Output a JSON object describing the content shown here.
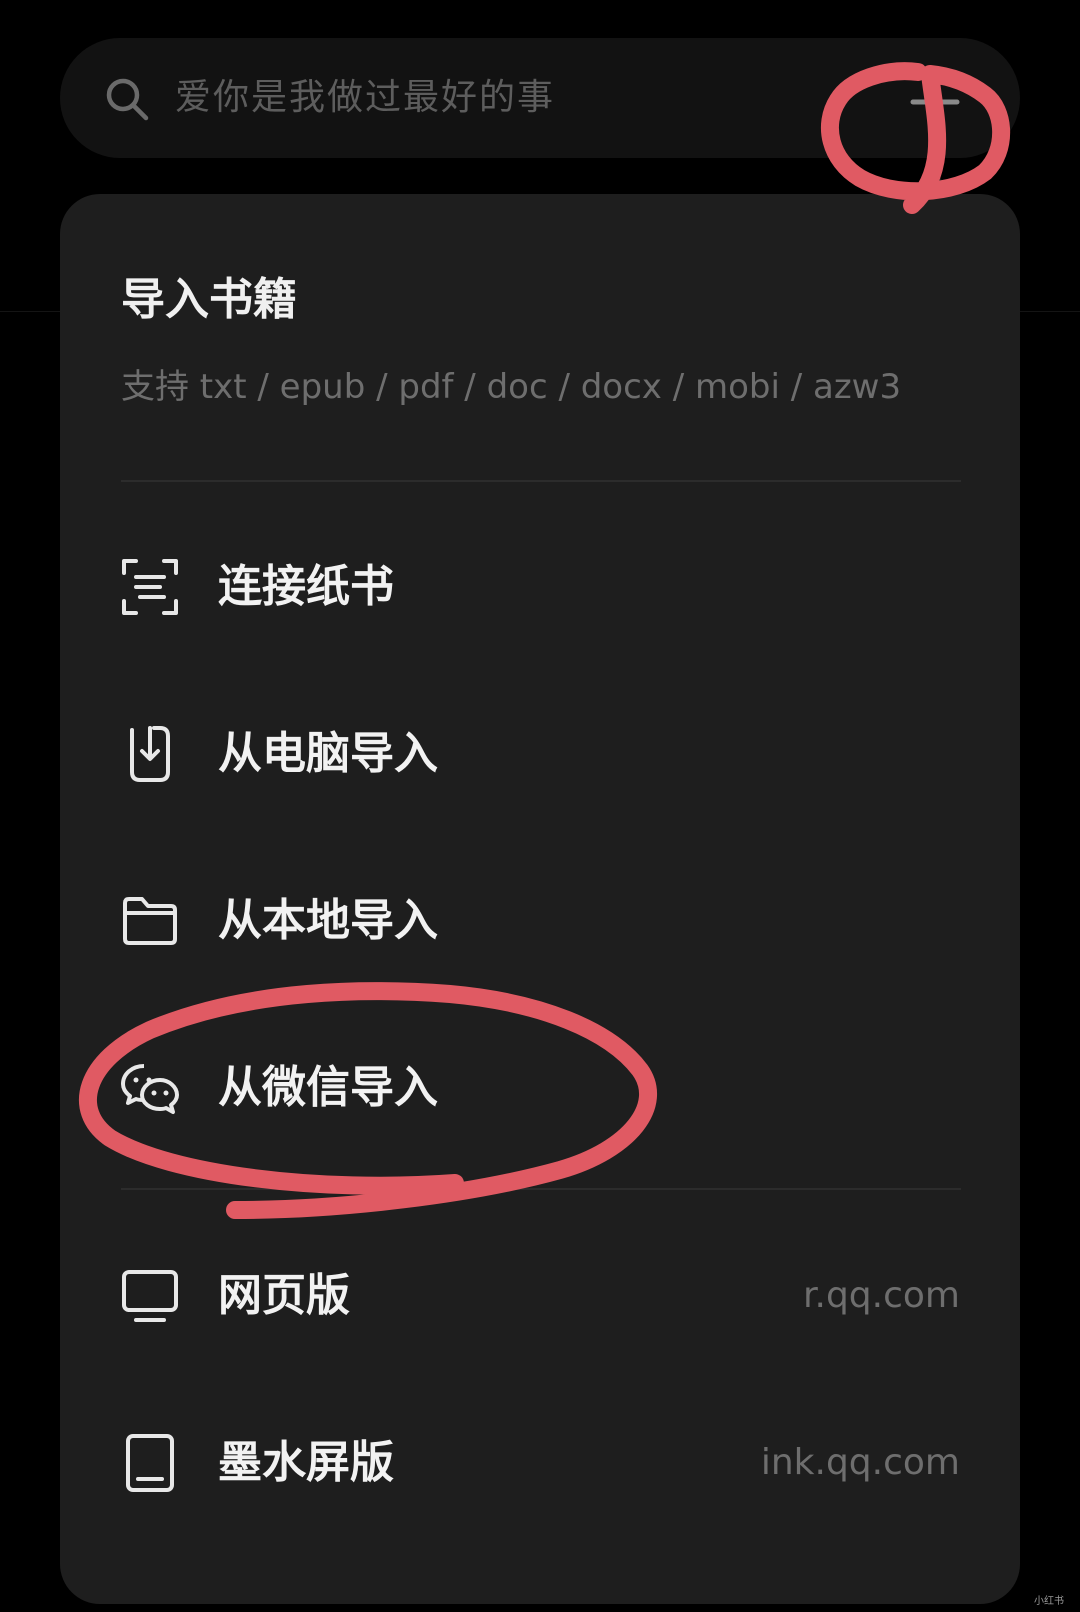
{
  "search": {
    "placeholder": "爱你是我做过最好的事",
    "icon": "search-icon",
    "add_icon": "plus-icon"
  },
  "panel": {
    "title": "导入书籍",
    "subtitle": "支持 txt / epub / pdf / doc / docx / mobi / azw3"
  },
  "menu": {
    "items": [
      {
        "label": "连接纸书",
        "icon": "scan-icon"
      },
      {
        "label": "从电脑导入",
        "icon": "phone-import-icon"
      },
      {
        "label": "从本地导入",
        "icon": "folder-icon"
      },
      {
        "label": "从微信导入",
        "icon": "wechat-icon"
      },
      {
        "label": "网页版",
        "value": "r.qq.com",
        "icon": "monitor-icon"
      },
      {
        "label": "墨水屏版",
        "value": "ink.qq.com",
        "icon": "tablet-icon"
      }
    ]
  },
  "watermark": "小红书",
  "colors": {
    "background": "#000000",
    "search_bg": "#121212",
    "panel_bg": "#1e1e1e",
    "text_primary": "#f2f2f2",
    "text_secondary": "#6e6e6e",
    "annotation": "#e05a63"
  }
}
